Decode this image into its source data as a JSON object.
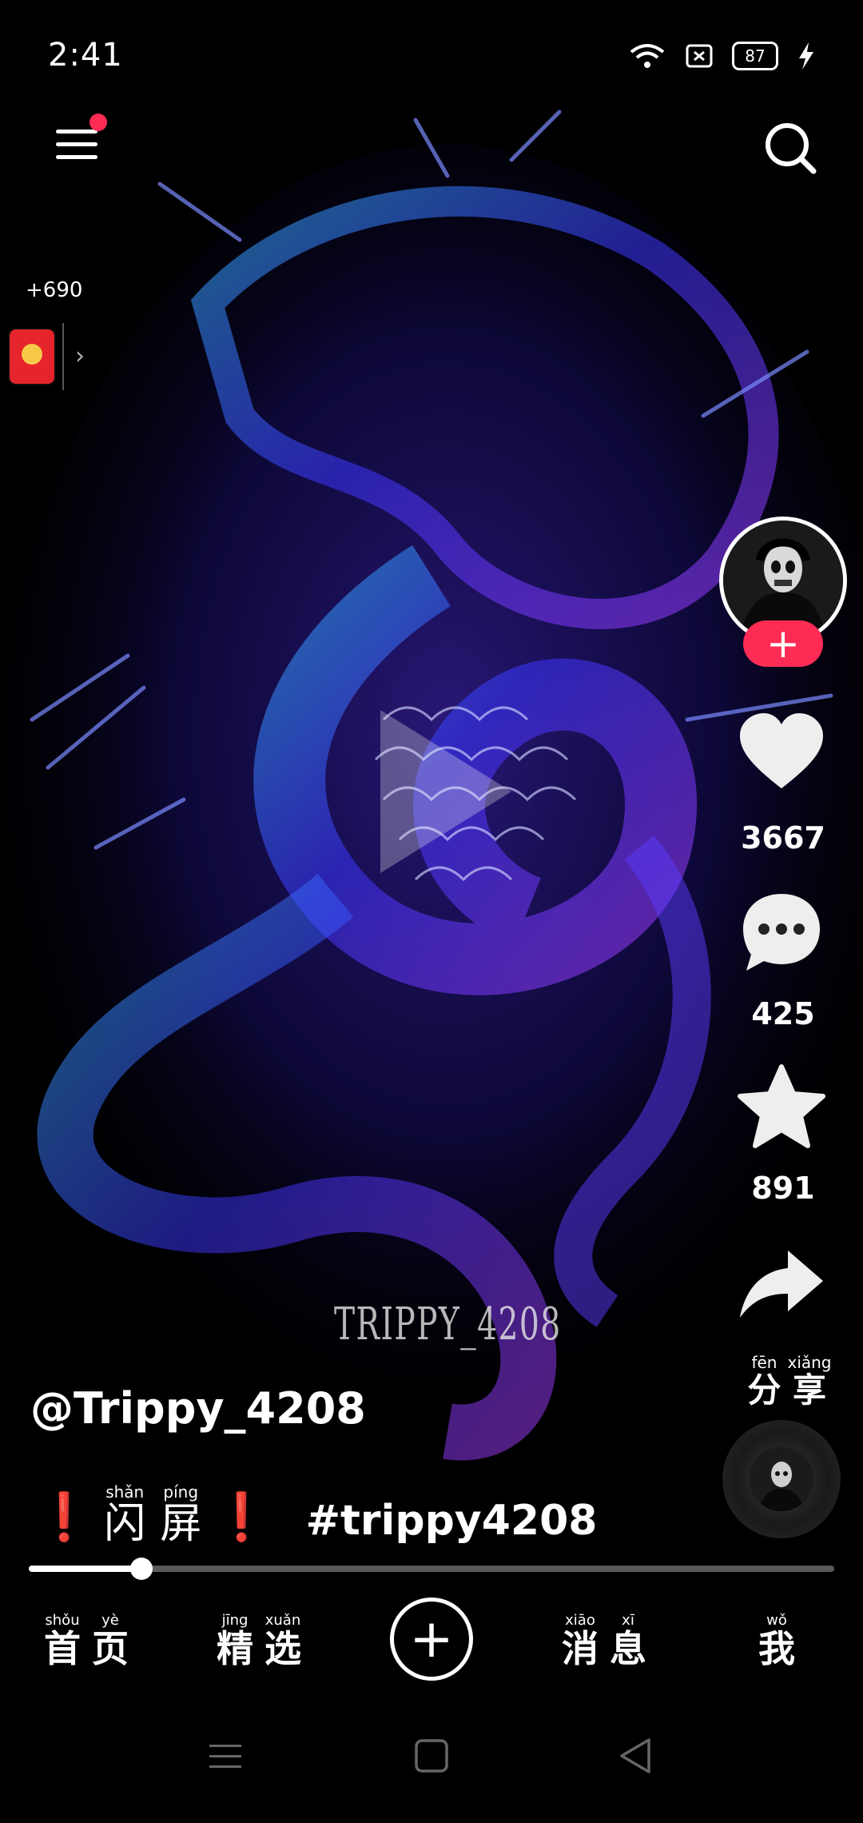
{
  "status_bar": {
    "time": "2:41",
    "battery": "87"
  },
  "reward": {
    "coins": "+690"
  },
  "video": {
    "watermark": "TRIPPY_4208"
  },
  "actions": {
    "likes": "3667",
    "comments": "425",
    "favorites": "891",
    "share_pinyin": [
      "fēn",
      "xiǎng"
    ],
    "share_hanzi": [
      "分",
      "享"
    ]
  },
  "post": {
    "username": "@Trippy_4208",
    "caption_pinyin": [
      "shǎn",
      "píng"
    ],
    "caption_hanzi": [
      "闪",
      "屏"
    ],
    "hashtag": "#trippy4208",
    "progress": 0.14
  },
  "tabs": [
    {
      "pinyin": [
        "shǒu",
        "yè"
      ],
      "hanzi": [
        "首",
        "页"
      ]
    },
    {
      "pinyin": [
        "jīng",
        "xuǎn"
      ],
      "hanzi": [
        "精",
        "选"
      ]
    },
    {
      "pinyin": [
        "xiāo",
        "xī"
      ],
      "hanzi": [
        "消",
        "息"
      ]
    },
    {
      "pinyin": [
        "wǒ"
      ],
      "hanzi": [
        "我"
      ]
    }
  ],
  "colors": {
    "accent": "#fe2c55",
    "background": "#000000",
    "dragon_blue": "#3b3bff",
    "dragon_purple": "#9b3dff",
    "dragon_cyan": "#36b6ff"
  },
  "icons": [
    "menu-icon",
    "search-icon",
    "heart-icon",
    "comment-icon",
    "star-icon",
    "share-icon",
    "plus-icon",
    "wifi-icon",
    "battery-icon",
    "charging-icon"
  ]
}
